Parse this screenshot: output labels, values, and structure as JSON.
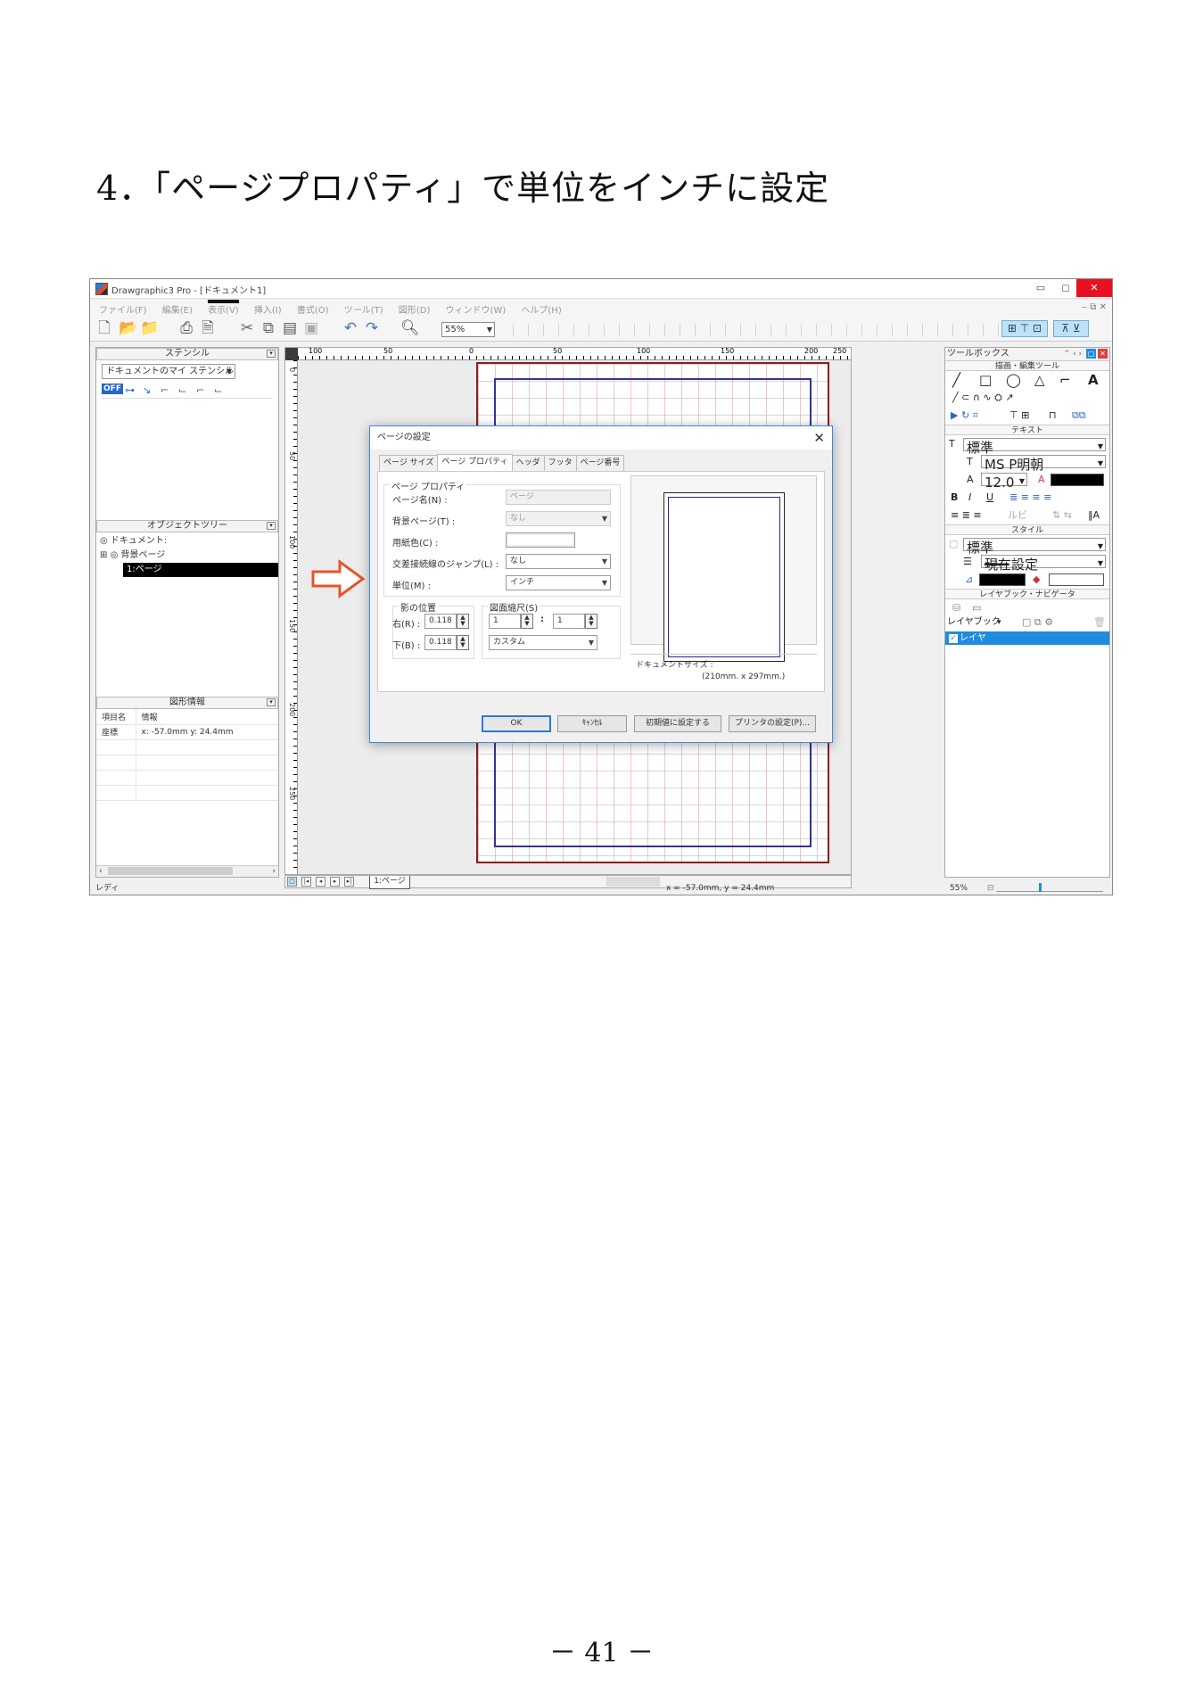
{
  "heading": "4．「ページプロパティ」で単位をインチに設定",
  "page_number": "－ 41 －",
  "window": {
    "title": "Drawgraphic3 Pro - [ドキュメント1]",
    "minimize": "▭",
    "maximize": "◻",
    "close": "✕",
    "mdi_controls": "‒ ⧉ ✕"
  },
  "menu": [
    "ファイル(F)",
    "編集(E)",
    "表示(V)",
    "挿入(I)",
    "書式(O)",
    "ツール(T)",
    "図形(D)",
    "ウィンドウ(W)",
    "ヘルプ(H)"
  ],
  "toolbar": {
    "zoom_value": "55%",
    "icons": [
      "new-document-icon",
      "open-folder-icon",
      "save-icon",
      "print-icon",
      "print-preview-icon",
      "cut-icon",
      "copy-icon",
      "paste-icon",
      "paste-special-icon",
      "undo-icon",
      "redo-icon",
      "zoom-icon"
    ]
  },
  "stencil_panel": {
    "header": "ステンシル",
    "select_value": "ドキュメントのマイ ステンシル",
    "off_badge": "OFF"
  },
  "object_tree": {
    "header": "オブジェクトツリー",
    "root": "ドキュメント:",
    "background_page": "背景ページ",
    "page": "1:ページ"
  },
  "shape_info": {
    "header": "図形情報",
    "col_item": "項目名",
    "col_info": "情報",
    "row_label": "座標",
    "row_value": "x: -57.0mm y:  24.4mm"
  },
  "ruler": {
    "h_labels": [
      "100",
      "50",
      "0",
      "50",
      "100",
      "150",
      "200",
      "250"
    ],
    "v_labels": [
      "0",
      "50",
      "100",
      "150",
      "200",
      "250"
    ]
  },
  "page_tab": "1:ページ",
  "statusbar": {
    "left": "レディ",
    "coords": "x =  -57.0mm, y =   24.4mm",
    "zoom": "55%"
  },
  "toolbox": {
    "title": "ツールボックス",
    "section_draw": "描画・編集ツール",
    "section_text": "テキスト",
    "text_style": "標準",
    "font_name": "MS P明朝",
    "font_size": "12.0",
    "section_style": "スタイル",
    "style_name": "標準",
    "line_setting": "現在設定",
    "section_layer": "レイヤブック・ナビゲータ",
    "layerbook_label": "レイヤブック",
    "layer_name": "レイヤ"
  },
  "dialog": {
    "title": "ページの設定",
    "tabs": [
      "ページ サイズ",
      "ページ プロパティ",
      "ヘッダ",
      "フッタ",
      "ページ番号"
    ],
    "active_tab": 1,
    "group_page_props": "ページ プロパティ",
    "page_name_label": "ページ名(N) :",
    "page_name_value": "ページ",
    "background_label": "背景ページ(T) :",
    "background_value": "なし",
    "paper_color_label": "用紙色(C) :",
    "jump_label": "交差接続線のジャンプ(L) :",
    "jump_value": "なし",
    "unit_label": "単位(M) :",
    "unit_value": "インチ",
    "shadow_group": "影の位置",
    "shadow_right_label": "右(R) :",
    "shadow_right_value": "0.118",
    "shadow_bottom_label": "下(B) :",
    "shadow_bottom_value": "0.118",
    "scale_group": "図面縮尺(S)",
    "scale_a": "1",
    "scale_colon": ":",
    "scale_b": "1",
    "scale_type": "カスタム",
    "docsize_label": "ドキュメントサイズ :",
    "docsize_value": "(210mm. x 297mm.)",
    "btn_ok": "OK",
    "btn_cancel": "ｷｬﾝｾﾙ",
    "btn_default": "初期値に設定する",
    "btn_printer": "プリンタの設定(P)..."
  },
  "colors": {
    "arrow": "#e8542a",
    "page_border": "#8b1d1d",
    "margin_line": "#32329a",
    "accent": "#1f8ce0"
  }
}
